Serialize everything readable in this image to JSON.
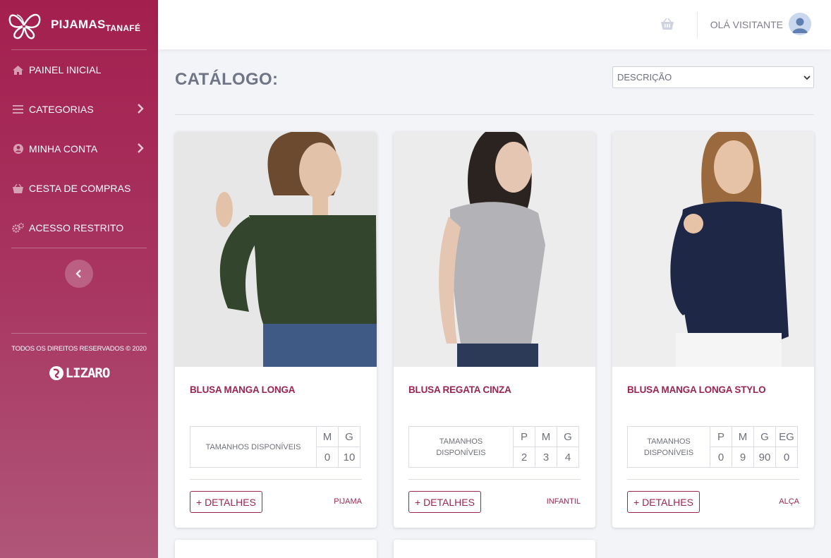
{
  "brand": {
    "name": "PIJAMAS",
    "sub": "TANAFÉ"
  },
  "sidebar": {
    "items": [
      {
        "label": "PAINEL INICIAL",
        "icon": "home-icon",
        "has_chevron": false
      },
      {
        "label": "CATEGORIAS",
        "icon": "list-icon",
        "has_chevron": true
      },
      {
        "label": "MINHA CONTA",
        "icon": "user-circle-icon",
        "has_chevron": true
      },
      {
        "label": "CESTA DE COMPRAS",
        "icon": "basket-icon",
        "has_chevron": false
      },
      {
        "label": "ACESSO RESTRITO",
        "icon": "gears-icon",
        "has_chevron": false
      }
    ],
    "copyright": "TODOS OS DIREITOS RESERVADOS © 2020",
    "developer_logo": "LIZARO"
  },
  "topbar": {
    "greeting": "OLÁ VISITANTE"
  },
  "main": {
    "title": "CATÁLOGO:",
    "sort": {
      "selected": "DESCRIÇÃO"
    },
    "details_label": "+ DETALHES",
    "products": [
      {
        "name": "BLUSA MANGA LONGA",
        "sizes_label": "TAMANHOS DISPONÍVEIS",
        "sizes": [
          "M",
          "G"
        ],
        "quantities": [
          "0",
          "10"
        ],
        "category": "PIJAMA",
        "colors": {
          "top": "#33452c",
          "bottom": "#3f5a85",
          "bg": "#e7e7e7",
          "hair": "#6b4a30"
        }
      },
      {
        "name": "BLUSA REGATA CINZA",
        "sizes_label": "TAMANHOS DISPONÍVEIS",
        "sizes": [
          "P",
          "M",
          "G"
        ],
        "quantities": [
          "2",
          "3",
          "4"
        ],
        "category": "INFANTIL",
        "colors": {
          "top": "#b3b3b7",
          "bottom": "#2d3a57",
          "bg": "#ececec",
          "hair": "#2b2320"
        }
      },
      {
        "name": "BLUSA MANGA LONGA STYLO",
        "sizes_label": "TAMANHOS DISPONÍVEIS",
        "sizes": [
          "P",
          "M",
          "G",
          "EG"
        ],
        "quantities": [
          "0",
          "9",
          "90",
          "0"
        ],
        "category": "ALÇA",
        "colors": {
          "top": "#1f2746",
          "bottom": "#f5f5f5",
          "bg": "#eeeeee",
          "hair": "#9a6a3e"
        }
      }
    ]
  }
}
